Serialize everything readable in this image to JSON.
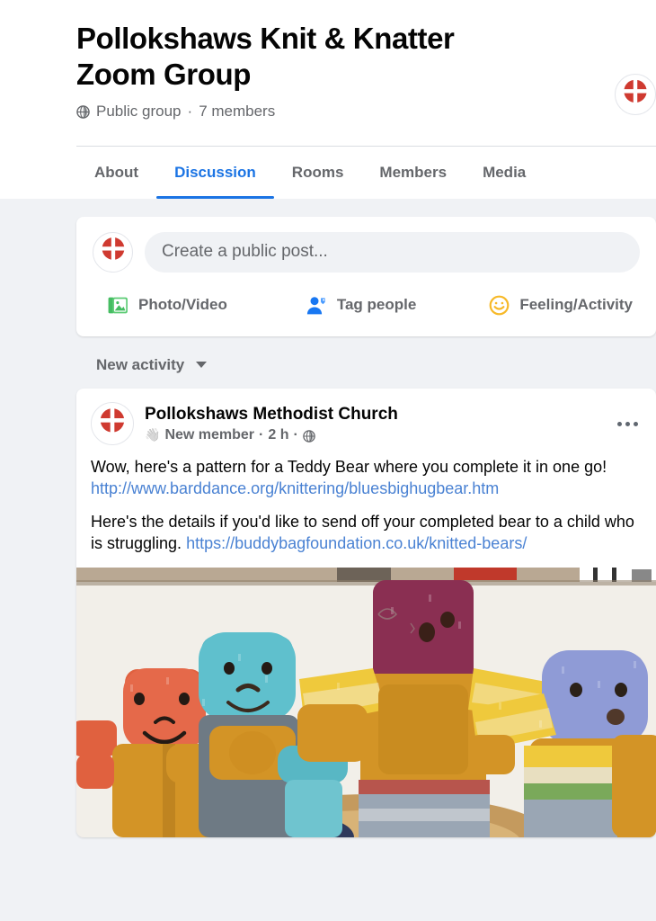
{
  "group": {
    "title": "Pollokshaws Knit & Knatter Zoom Group",
    "privacy_label": "Public group",
    "separator": "·",
    "members_label": "7 members",
    "privacy_icon": "globe-icon",
    "avatar_icon": "group-logo-avatar"
  },
  "tabs": [
    {
      "label": "About",
      "active": false
    },
    {
      "label": "Discussion",
      "active": true
    },
    {
      "label": "Rooms",
      "active": false
    },
    {
      "label": "Members",
      "active": false
    },
    {
      "label": "Media",
      "active": false
    }
  ],
  "composer": {
    "placeholder": "Create a public post...",
    "avatar_icon": "group-logo-avatar",
    "actions": [
      {
        "label": "Photo/Video",
        "icon": "photo-video-icon",
        "color": "#45bd62"
      },
      {
        "label": "Tag people",
        "icon": "tag-people-icon",
        "color": "#1877f2"
      },
      {
        "label": "Feeling/Activity",
        "icon": "feeling-activity-icon",
        "color": "#f7b928"
      }
    ]
  },
  "feed": {
    "sorter_label": "New activity",
    "sorter_icon": "chevron-down-icon"
  },
  "post": {
    "author": "Pollokshaws Methodist Church",
    "badge_icon": "waving-hand-icon",
    "badge_label": "New member",
    "sep1": "·",
    "timestamp": "2 h",
    "sep2": "·",
    "audience_icon": "globe-icon",
    "menu_icon": "more-options-icon",
    "paragraph_1_before": "Wow, here's a pattern for a Teddy Bear where you complete it in one go! ",
    "link_1": "http://www.barddance.org/knittering/bluesbighugbear.htm",
    "paragraph_2_before": "Here's the details if you'd like to send off your completed bear to a child who is struggling. ",
    "link_2": "https://buddybagfoundation.co.uk/knitted-bears/",
    "photo_alt": "knitted-teddy-bears-photo"
  },
  "colors": {
    "accent_blue": "#1b74e4",
    "link_blue": "#4a82d3",
    "page_bg": "#f0f2f5",
    "card_bg": "#ffffff",
    "text_primary": "#050505",
    "text_secondary": "#65676b",
    "logo_red": "#cf3a30"
  }
}
